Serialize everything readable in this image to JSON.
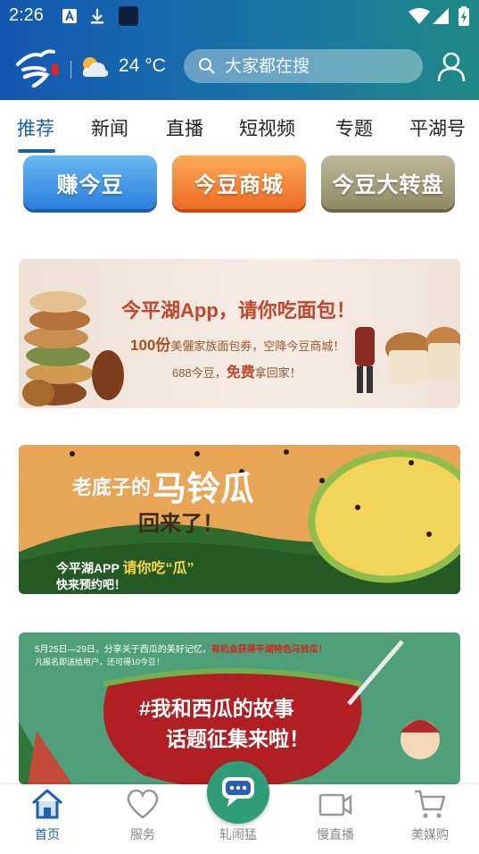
{
  "status_bar": {
    "time": "2:26"
  },
  "header": {
    "temperature": "24 °C",
    "weather_icon": "partly-cloudy-icon",
    "logo_icon": "jin-logo-icon"
  },
  "search": {
    "placeholder": "大家都在搜"
  },
  "tabs": [
    {
      "label": "推荐",
      "active": true
    },
    {
      "label": "新闻"
    },
    {
      "label": "直播"
    },
    {
      "label": "短视频"
    },
    {
      "label": "专题"
    },
    {
      "label": "平湖号"
    }
  ],
  "quick_buttons": [
    {
      "label": "赚今豆",
      "color": "#2a7fdc"
    },
    {
      "label": "今豆商城",
      "color": "#ee6b23"
    },
    {
      "label": "今豆大转盘",
      "color": "#8e8a65"
    }
  ],
  "banner1": {
    "title": "今平湖App，请你吃面包！",
    "count": "100份",
    "desc": "美儷家族面包券，空降今豆商城！",
    "price": "688今豆，",
    "free": "免费",
    "tail": "拿回家！"
  },
  "banner2": {
    "line1": "老底子的",
    "big": "马铃瓜",
    "line2": "回来了！",
    "line3a": "今平湖APP",
    "line3b": "请你吃“瓜”",
    "line4": "快来预约吧！"
  },
  "banner3": {
    "note1a": "5月25日—29日，分享关于西瓜的美好记忆，",
    "note1b": "有机会获得平湖特色马铃瓜！",
    "note2": "凡报名即送给用户，还可得10今豆！",
    "topic1": "#我和西瓜的故事",
    "topic2": "话题征集来啦！"
  },
  "bottom_nav": [
    {
      "label": "首页",
      "icon": "home-icon",
      "active": true
    },
    {
      "label": "服务",
      "icon": "heart-icon"
    },
    {
      "label": "轧闹猛",
      "icon": "chat-icon"
    },
    {
      "label": "慢直播",
      "icon": "video-camera-icon"
    },
    {
      "label": "美媒购",
      "icon": "cart-icon"
    }
  ],
  "colors": {
    "header_start": "#1358b4",
    "header_end": "#1f8a86",
    "accent": "#1a5fb0",
    "center_button": "#2f9d78"
  }
}
